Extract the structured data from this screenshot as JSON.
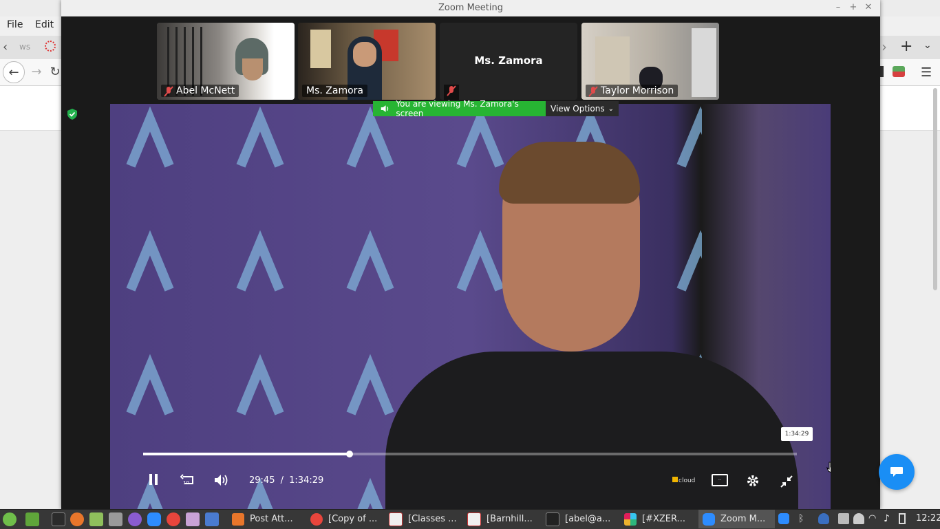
{
  "browser": {
    "menu": [
      "File",
      "Edit"
    ],
    "tab_fragment": "ws"
  },
  "zoom": {
    "window_title": "Zoom Meeting",
    "participants": [
      {
        "name": "Abel McNett",
        "muted": true,
        "video": true
      },
      {
        "name": "Ms. Zamora",
        "muted": false,
        "video": true
      },
      {
        "name": "Ms. Zamora",
        "muted": true,
        "video": false
      },
      {
        "name": "Taylor Morrison",
        "muted": true,
        "video": true
      }
    ],
    "share_banner": {
      "text": "You are viewing Ms. Zamora's screen",
      "view_options": "View Options"
    }
  },
  "video_player": {
    "current_time": "29:45",
    "separator": "/",
    "total_time": "1:34:29",
    "hover_time": "1:34:29",
    "progress": 0.316,
    "replay_seconds": "10",
    "brand": "cloud"
  },
  "taskbar": {
    "tasks": [
      {
        "label": "Post Att...",
        "icon": "firefox-icon"
      },
      {
        "label": "[Copy of ...",
        "icon": "chrome-icon"
      },
      {
        "label": "[Classes ...",
        "icon": "classes-app-icon"
      },
      {
        "label": "[Barnhill...",
        "icon": "classes-app-icon"
      },
      {
        "label": "[abel@a...",
        "icon": "terminal-icon"
      },
      {
        "label": "[#XZER...",
        "icon": "slack-icon"
      },
      {
        "label": "Zoom M...",
        "icon": "zoom-icon"
      }
    ],
    "clock": "12:22"
  }
}
